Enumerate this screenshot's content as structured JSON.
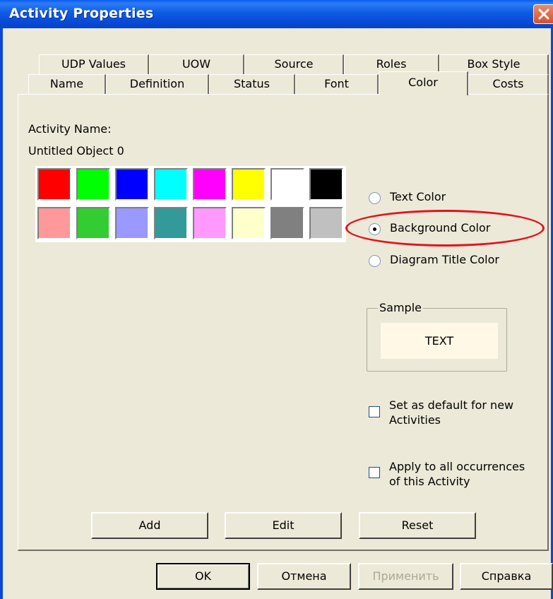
{
  "window": {
    "title": "Activity Properties",
    "close_icon": "close-icon"
  },
  "tabs_row_back": [
    {
      "label": "UDP Values"
    },
    {
      "label": "UOW"
    },
    {
      "label": "Source"
    },
    {
      "label": "Roles"
    },
    {
      "label": "Box Style"
    }
  ],
  "tabs_row_front": [
    {
      "label": "Name"
    },
    {
      "label": "Definition"
    },
    {
      "label": "Status"
    },
    {
      "label": "Font"
    },
    {
      "label": "Color",
      "active": true
    },
    {
      "label": "Costs"
    }
  ],
  "activity": {
    "name_label": "Activity Name:",
    "name_value": "Untitled Object 0"
  },
  "palette": {
    "colors": [
      "#FF0000",
      "#00FF00",
      "#0000FF",
      "#00FFFF",
      "#FF00FF",
      "#FFFF00",
      "#FFFFFF",
      "#000000",
      "#FF9999",
      "#33CC33",
      "#9999FF",
      "#339999",
      "#FF99FF",
      "#FFFFCC",
      "#808080",
      "#C0C0C0"
    ]
  },
  "color_target": {
    "options": [
      {
        "label": "Text Color",
        "checked": false
      },
      {
        "label": "Background Color",
        "checked": true
      },
      {
        "label": "Diagram Title Color",
        "checked": false
      }
    ],
    "highlight_color": "#E0141E"
  },
  "sample": {
    "group_label": "Sample",
    "text": "TEXT",
    "background": "#FFF8E7"
  },
  "options": {
    "default_line1": "Set as default for new",
    "default_line2": "Activities",
    "apply_line1": "Apply to all occurrences",
    "apply_line2": "of this Activity"
  },
  "actions": {
    "add": "Add",
    "edit": "Edit",
    "reset": "Reset"
  },
  "footer": {
    "ok": "OK",
    "cancel": "Отмена",
    "apply": "Применить",
    "help": "Справка"
  }
}
